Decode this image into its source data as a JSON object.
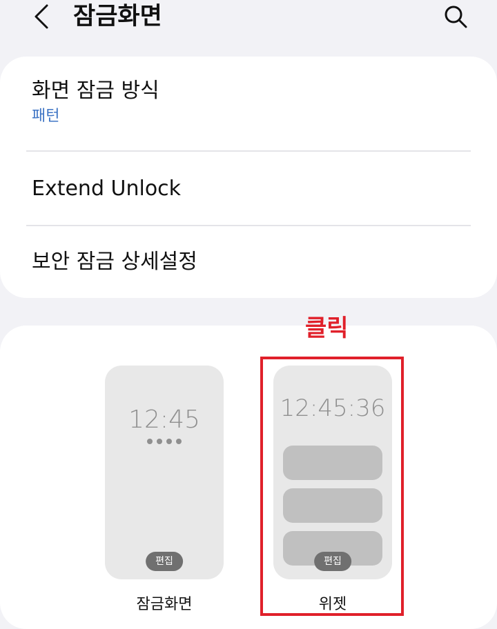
{
  "header": {
    "title": "잠금화면"
  },
  "settings": {
    "screen_lock_type": {
      "title": "화면 잠금 방식",
      "value": "패턴"
    },
    "extend_unlock": {
      "title": "Extend Unlock"
    },
    "secure_lock_settings": {
      "title": "보안 잠금 상세설정"
    }
  },
  "preview": {
    "lock_screen": {
      "time": "12:45",
      "edit_label": "편집",
      "label": "잠금화면"
    },
    "widgets": {
      "time": "12:45:36",
      "edit_label": "편집",
      "label": "위젯"
    }
  },
  "annotation": {
    "text": "클릭",
    "color": "#e0202a"
  },
  "colors": {
    "accent_blue": "#3e74c4",
    "background": "#f2f2f6",
    "card": "#ffffff"
  },
  "icons": {
    "back": "chevron-left-icon",
    "search": "search-icon"
  }
}
